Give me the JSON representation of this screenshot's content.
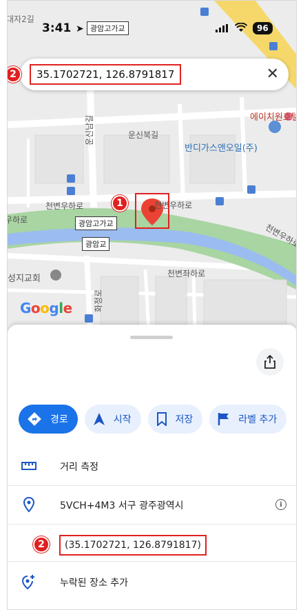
{
  "status_bar": {
    "time": "3:41",
    "map_chip": "광암고가교",
    "battery": "96"
  },
  "search": {
    "value": "35.1702721, 126.8791817"
  },
  "map": {
    "labels": {
      "top_left": "대자2길",
      "road1": "운신북길",
      "poi_gas": "반디가스앤오일(주)",
      "poi_red": "에이치원호텔",
      "road2": "운신남길",
      "road3_left": "천변우하로",
      "road3_mid": "천변우하로",
      "road3_left2": "우하로",
      "road_right": "천변우하로",
      "road_bottom": "천변좌하로",
      "church": "성지교회",
      "chip_bridge": "광암고가교",
      "chip_bridge2": "광암교",
      "road_vertical2": "화정로",
      "google": "Google"
    },
    "badge1": "1",
    "badge2": "2"
  },
  "sheet": {
    "actions": [
      {
        "label": "경로"
      },
      {
        "label": "시작"
      },
      {
        "label": "저장"
      },
      {
        "label": "라벨 추가"
      }
    ],
    "rows": {
      "measure": "거리 측정",
      "plus_code": "5VCH+4M3 서구 광주광역시",
      "coords": "(35.1702721, 126.8791817)",
      "add_place": "누락된 장소 추가"
    },
    "badge2": "2"
  },
  "colors": {
    "accent": "#1a73e8",
    "highlight": "#e02020",
    "river": "#9bbcf0",
    "park": "#a8d5a2"
  }
}
